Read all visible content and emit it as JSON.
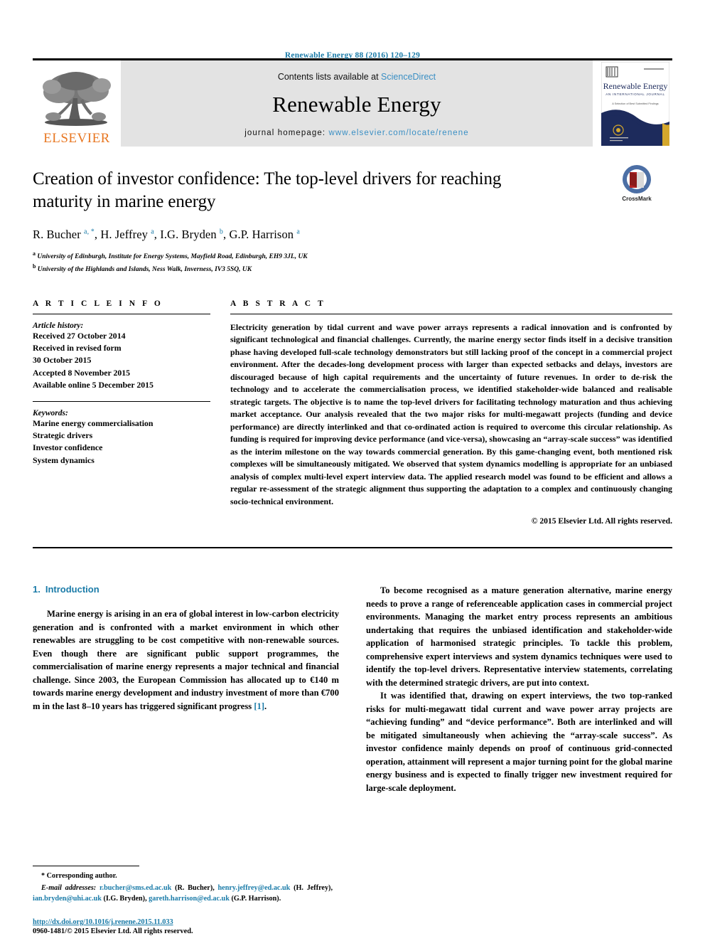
{
  "running_head": "Renewable Energy 88 (2016) 120–129",
  "masthead": {
    "publisher_logo_text": "ELSEVIER",
    "contents_prefix": "Contents lists available at ",
    "contents_link": "ScienceDirect",
    "journal_name": "Renewable Energy",
    "homepage_prefix": "journal homepage: ",
    "homepage_url": "www.elsevier.com/locate/renene",
    "cover": {
      "title": "Renewable Energy",
      "subtitle": "AN INTERNATIONAL JOURNAL",
      "editor_line": "A Selection of Best Submitted Findings"
    }
  },
  "article": {
    "title": "Creation of investor confidence: The top-level drivers for reaching maturity in marine energy",
    "crossmark_label": "CrossMark",
    "authors_html": "R. Bucher <sup>a, *</sup>, H. Jeffrey <sup>a</sup>, I.G. Bryden <sup>b</sup>, G.P. Harrison <sup>a</sup>",
    "affiliations": [
      {
        "marker": "a",
        "text": "University of Edinburgh, Institute for Energy Systems, Mayfield Road, Edinburgh, EH9 3JL, UK"
      },
      {
        "marker": "b",
        "text": "University of the Highlands and Islands, Ness Walk, Inverness, IV3 5SQ, UK"
      }
    ]
  },
  "article_info": {
    "heading": "A R T I C L E   I N F O",
    "history_label": "Article history:",
    "history": [
      "Received 27 October 2014",
      "Received in revised form",
      "30 October 2015",
      "Accepted 8 November 2015",
      "Available online 5 December 2015"
    ],
    "keywords_label": "Keywords:",
    "keywords": [
      "Marine energy commercialisation",
      "Strategic drivers",
      "Investor confidence",
      "System dynamics"
    ]
  },
  "abstract": {
    "heading": "A B S T R A C T",
    "text": "Electricity generation by tidal current and wave power arrays represents a radical innovation and is confronted by significant technological and financial challenges. Currently, the marine energy sector finds itself in a decisive transition phase having developed full-scale technology demonstrators but still lacking proof of the concept in a commercial project environment. After the decades-long development process with larger than expected setbacks and delays, investors are discouraged because of high capital requirements and the uncertainty of future revenues. In order to de-risk the technology and to accelerate the commercialisation process, we identified stakeholder-wide balanced and realisable strategic targets. The objective is to name the top-level drivers for facilitating technology maturation and thus achieving market acceptance. Our analysis revealed that the two major risks for multi-megawatt projects (funding and device performance) are directly interlinked and that co-ordinated action is required to overcome this circular relationship. As funding is required for improving device performance (and vice-versa), showcasing an “array-scale success” was identified as the interim milestone on the way towards commercial generation. By this game-changing event, both mentioned risk complexes will be simultaneously mitigated. We observed that system dynamics modelling is appropriate for an unbiased analysis of complex multi-level expert interview data. The applied research model was found to be efficient and allows a regular re-assessment of the strategic alignment thus supporting the adaptation to a complex and continuously changing socio-technical environment.",
    "copyright": "© 2015 Elsevier Ltd. All rights reserved."
  },
  "body": {
    "section_number": "1.",
    "section_title": "Introduction",
    "left_paragraph": "Marine energy is arising in an era of global interest in low-carbon electricity generation and is confronted with a market environment in which other renewables are struggling to be cost competitive with non-renewable sources. Even though there are significant public support programmes, the commercialisation of marine energy represents a major technical and financial challenge. Since 2003, the European Commission has allocated up to €140 m towards marine energy development and industry investment of more than €700 m in the last 8–10 years has triggered significant progress ",
    "left_paragraph_ref": "[1]",
    "right_paragraph_1": "To become recognised as a mature generation alternative, marine energy needs to prove a range of referenceable application cases in commercial project environments. Managing the market entry process represents an ambitious undertaking that requires the unbiased identification and stakeholder-wide application of harmonised strategic principles. To tackle this problem, comprehensive expert interviews and system dynamics techniques were used to identify the top-level drivers. Representative interview statements, correlating with the determined strategic drivers, are put into context.",
    "right_paragraph_2": "It was identified that, drawing on expert interviews, the two top-ranked risks for multi-megawatt tidal current and wave power array projects are “achieving funding” and “device performance”. Both are interlinked and will be mitigated simultaneously when achieving the “array-scale success”. As investor confidence mainly depends on proof of continuous grid-connected operation, attainment will represent a major turning point for the global marine energy business and is expected to finally trigger new investment required for large-scale deployment."
  },
  "footer": {
    "corresponding_marker": "*",
    "corresponding_text": "Corresponding author.",
    "email_label": "E-mail addresses:",
    "emails": [
      {
        "address": "r.bucher@sms.ed.ac.uk",
        "name": "(R. Bucher)"
      },
      {
        "address": "henry.jeffrey@ed.ac.uk",
        "name": "(H. Jeffrey)"
      },
      {
        "address": "ian.bryden@uhi.ac.uk",
        "name": "(I.G. Bryden)"
      },
      {
        "address": "gareth.harrison@ed.ac.uk",
        "name": "(G.P. Harrison)"
      }
    ],
    "doi": "http://dx.doi.org/10.1016/j.renene.2015.11.033",
    "issn": "0960-1481/© 2015 Elsevier Ltd. All rights reserved."
  },
  "colors": {
    "link_blue": "#1a7ba8",
    "sciencedirect_blue": "#3a8fc4",
    "elsevier_orange": "#E87722",
    "band_grey": "#e3e3e3",
    "cover_navy": "#1d2b5c",
    "cover_gold": "#d4a72c"
  }
}
